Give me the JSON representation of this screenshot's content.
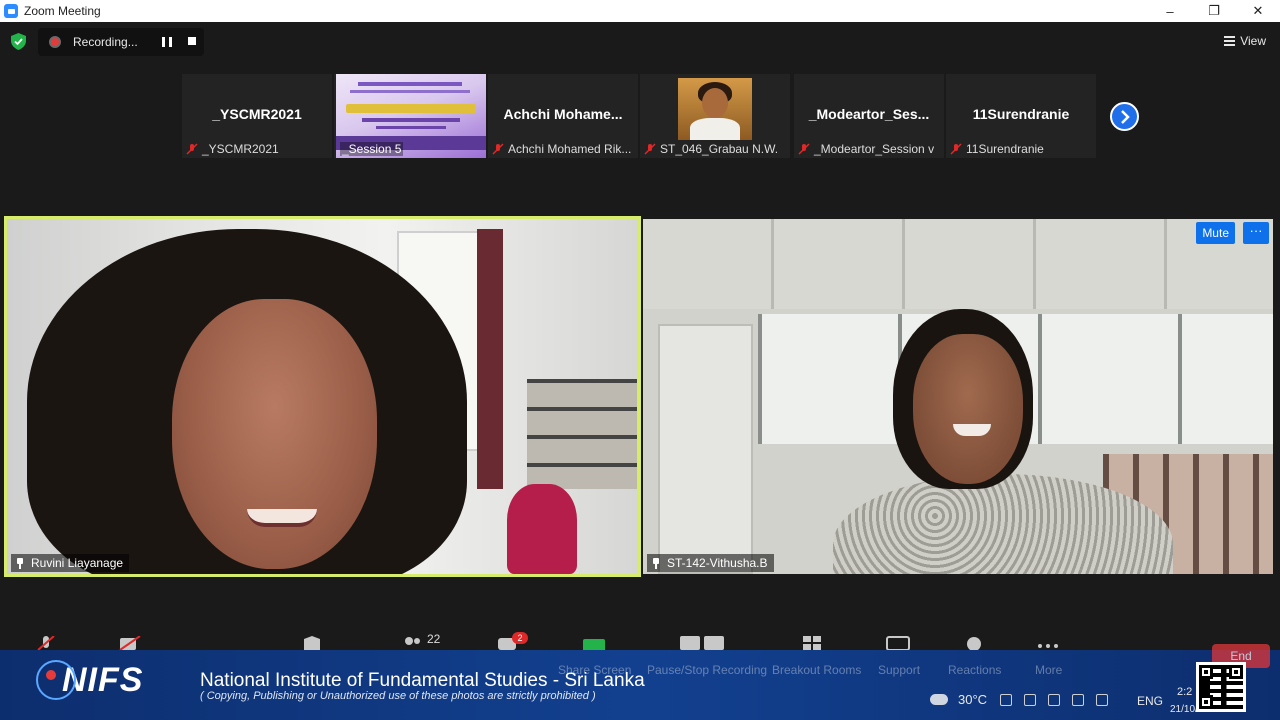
{
  "window": {
    "title": "Zoom Meeting",
    "minimize": "–",
    "restore": "❐",
    "close": "✕"
  },
  "recording": {
    "label": "Recording..."
  },
  "view": {
    "label": "View"
  },
  "thumbnails": [
    {
      "big_name": "_YSCMR2021",
      "small_name": "_YSCMR2021",
      "muted": true
    },
    {
      "type": "poster",
      "small_name": "_Session 5"
    },
    {
      "big_name": "Achchi Mohame...",
      "small_name": "Achchi Mohamed Rik...",
      "muted": true
    },
    {
      "type": "photo",
      "small_name": "ST_046_Grabau N.W.",
      "muted": true
    },
    {
      "big_name": "_Modeartor_Ses...",
      "small_name": "_Modeartor_Session v",
      "muted": true
    },
    {
      "big_name": "11Surendranie",
      "small_name": "11Surendranie",
      "muted": true
    }
  ],
  "videos": {
    "left": {
      "name": "Ruvini Liayanage"
    },
    "right": {
      "name": "ST-142-Vithusha.B",
      "mute_label": "Mute",
      "more_label": "···"
    }
  },
  "toolbar": {
    "participants_count": "22",
    "chat_badge": "2"
  },
  "banner": {
    "logo": "NIFS",
    "title": "National Institute of Fundamental Studies - Sri Lanka",
    "subtitle": "( Copying, Publishing or Unauthorized use of these photos are strictly prohibited )",
    "ghost_labels": [
      "Share Screen",
      "Pause/Stop Recording",
      "Breakout Rooms",
      "Support",
      "Reactions",
      "More"
    ],
    "end_label": "End"
  },
  "tray": {
    "temperature": "30°C",
    "language": "ENG",
    "time": "2:2",
    "date": "21/10/2021"
  },
  "colors": {
    "accent": "#0e71eb",
    "active_speaker": "#d6ec6a",
    "record": "#e03c3c",
    "banner": "#12408f"
  }
}
